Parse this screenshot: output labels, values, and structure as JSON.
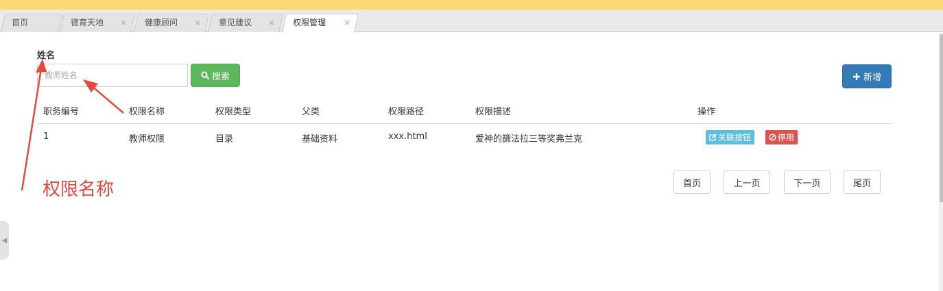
{
  "tabs": [
    {
      "label": "首页",
      "closable": false
    },
    {
      "label": "德育天地",
      "closable": true
    },
    {
      "label": "健康顾问",
      "closable": true
    },
    {
      "label": "意见建议",
      "closable": true
    },
    {
      "label": "权限管理",
      "closable": true,
      "active": true
    }
  ],
  "tab_close_glyph": "×",
  "search": {
    "label": "姓名",
    "placeholder": "教师姓名",
    "button_label": "搜索",
    "button_icon": "search-icon"
  },
  "add_button": {
    "label": "新增",
    "icon": "plus-icon"
  },
  "table": {
    "headers": [
      "职务编号",
      "权限名称",
      "权限类型",
      "父类",
      "权限路径",
      "权限描述",
      "操作"
    ],
    "rows": [
      {
        "id": "1",
        "name": "教师权限",
        "type": "目录",
        "parent": "基础资料",
        "path": "xxx.html",
        "description": "爱神的篩法拉三等奖弗兰克",
        "actions": {
          "link_label": "关联按钮",
          "disable_label": "停用"
        }
      }
    ]
  },
  "pagination": {
    "first": "首页",
    "prev": "上一页",
    "next": "下一页",
    "last": "尾页"
  },
  "annotation": {
    "text": "权限名称",
    "color": "#e8473f"
  },
  "colors": {
    "search_button": "#5cb85c",
    "add_button": "#337ab7",
    "link_badge": "#5bc0de",
    "disable_badge": "#d9534f",
    "top_bar": "#fbd977"
  }
}
